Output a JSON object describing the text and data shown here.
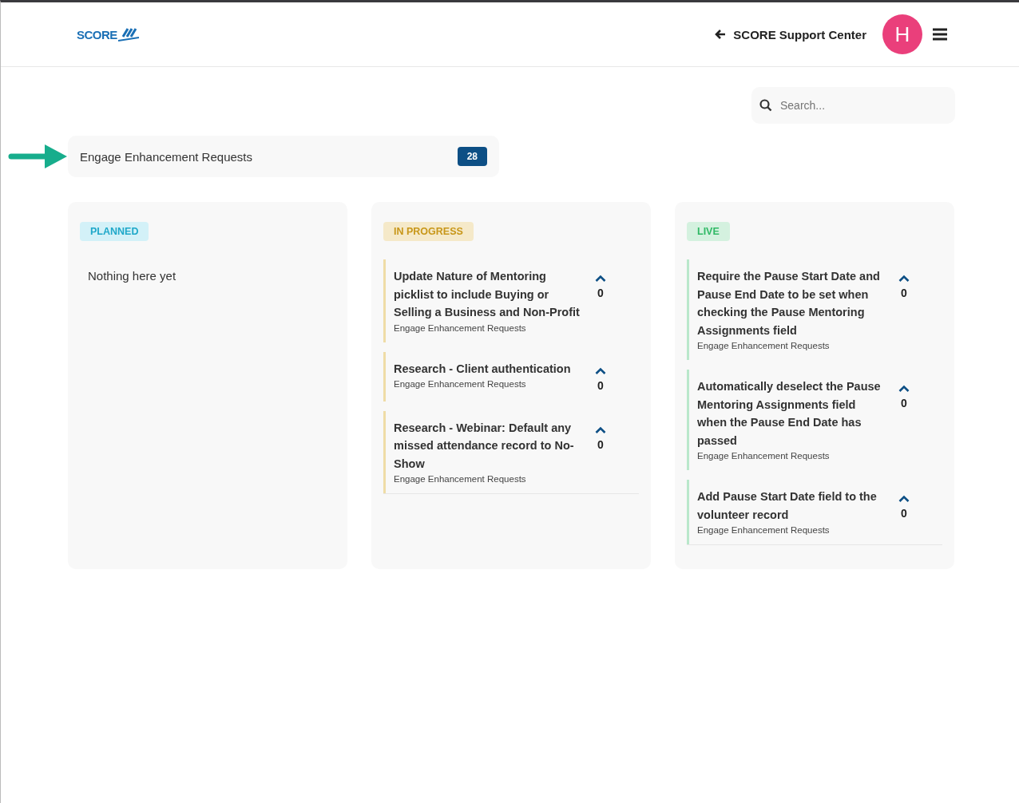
{
  "header": {
    "logo": "SCORE",
    "support_link": "SCORE Support Center",
    "avatar_initial": "H"
  },
  "search": {
    "placeholder": "Search..."
  },
  "board": {
    "title": "Engage Enhancement Requests",
    "count": "28"
  },
  "columns": [
    {
      "label": "PLANNED",
      "kind": "planned",
      "empty_text": "Nothing here yet"
    },
    {
      "label": "IN PROGRESS",
      "kind": "in_progress",
      "posts": [
        {
          "title": "Update Nature of Mentoring picklist to include Buying or Selling a Business and Non-Profit",
          "board": "Engage Enhancement Requests",
          "votes": "0"
        },
        {
          "title": "Research - Client authentication",
          "board": "Engage Enhancement Requests",
          "votes": "0"
        },
        {
          "title": "Research - Webinar: Default any missed attendance record to No-Show",
          "board": "Engage Enhancement Requests",
          "votes": "0"
        }
      ]
    },
    {
      "label": "LIVE",
      "kind": "live",
      "posts": [
        {
          "title": "Require the Pause Start Date and Pause End Date to be set when checking the Pause Mentoring Assignments field",
          "board": "Engage Enhancement Requests",
          "votes": "0"
        },
        {
          "title": "Automatically deselect the Pause Mentoring Assignments field when the Pause End Date has passed",
          "board": "Engage Enhancement Requests",
          "votes": "0"
        },
        {
          "title": "Add Pause Start Date field to the volunteer record",
          "board": "Engage Enhancement Requests",
          "votes": "0"
        }
      ]
    }
  ]
}
